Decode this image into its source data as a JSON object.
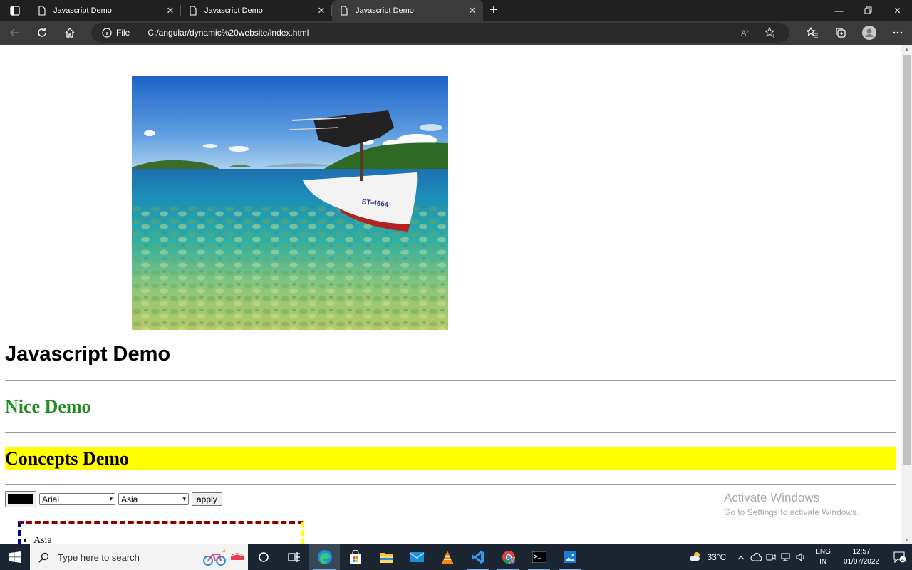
{
  "browser": {
    "tabs": [
      {
        "title": "Javascript Demo",
        "active": false
      },
      {
        "title": "Javascript Demo",
        "active": false
      },
      {
        "title": "Javascript Demo",
        "active": true
      }
    ],
    "address": {
      "info_label": "File",
      "url": "C:/angular/dynamic%20website/index.html"
    }
  },
  "page": {
    "hero_image_alt": "boat",
    "boat_text": "ST-4664",
    "heading": "Javascript Demo",
    "subheading_green": "Nice Demo",
    "subheading_yellow": "Concepts Demo",
    "controls": {
      "color_value": "#000000",
      "font_select": "Arial",
      "region_select": "Asia",
      "apply_label": "apply"
    },
    "list_items": [
      "Asia"
    ]
  },
  "watermark": {
    "line1": "Activate Windows",
    "line2": "Go to Settings to activate Windows."
  },
  "taskbar": {
    "search_placeholder": "Type here to search",
    "temperature": "33°C",
    "lang_line1": "ENG",
    "lang_line2": "IN",
    "time": "12:57",
    "date": "01/07/2022",
    "notification_count": "4"
  },
  "colors": {
    "green_heading": "#228b22",
    "yellow_bg": "#ffff00",
    "border_top": "#8b0000",
    "border_left": "#00008b",
    "border_right": "#ffff00"
  }
}
